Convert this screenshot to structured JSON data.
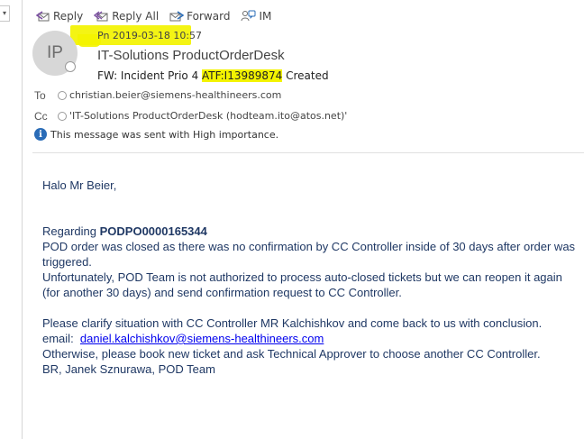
{
  "toolbar": {
    "reply_label": "Reply",
    "reply_all_label": "Reply All",
    "forward_label": "Forward",
    "im_label": "IM"
  },
  "header": {
    "avatar_initials": "IP",
    "date": "Pn 2019-03-18 10:57",
    "sender": "IT-Solutions ProductOrderDesk",
    "subject_prefix": "FW: Incident Prio 4 ",
    "subject_id": "ATF:I13989874",
    "subject_suffix": " Created",
    "to_label": "To",
    "to_value": "christian.beier@siemens-healthineers.com",
    "cc_label": "Cc",
    "cc_value": "'IT-Solutions ProductOrderDesk (hodteam.ito@atos.net)'",
    "importance_note": "This message was sent with High importance."
  },
  "body": {
    "greeting": "Halo Mr Beier,",
    "regarding_label": "Regarding ",
    "regarding_id": "PODPO0000165344",
    "line1": "POD order was closed as there was no confirmation by CC Controller inside of 30 days after order was",
    "line2": "triggered.",
    "line3": "Unfortunately, POD Team is not authorized to process auto-closed tickets but we can reopen it again",
    "line4": "(for another 30 days) and send confirmation request to CC Controller.",
    "line5": "Please clarify situation with CC Controller MR Kalchishkov and come back to us with conclusion.",
    "email_label": "email:  ",
    "email_link": "daniel.kalchishkov@siemens-healthineers.com",
    "line6": "Otherwise, please book new ticket and ask Technical Approver to choose another CC Controller.",
    "signature": "BR, Janek Sznurawa, POD Team"
  },
  "colors": {
    "highlight": "#f3f300",
    "body_text": "#1f3864",
    "link": "#0000ee",
    "info": "#2a6cb7"
  }
}
